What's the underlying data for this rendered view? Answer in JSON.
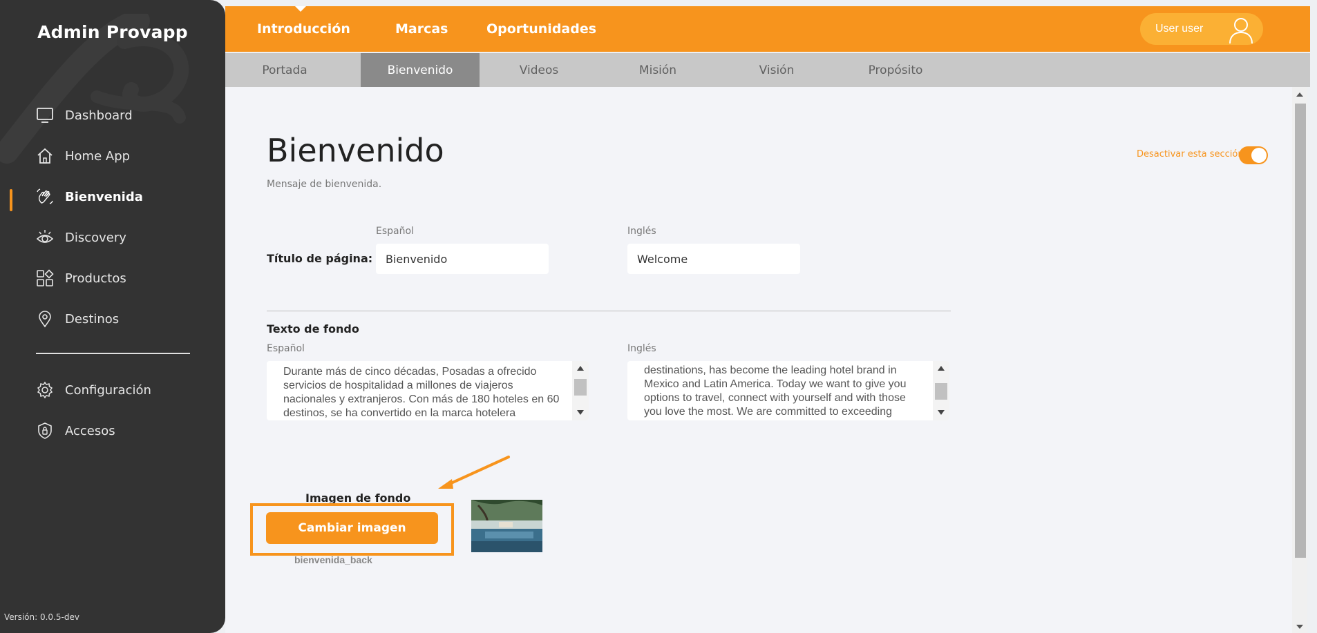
{
  "sidebar": {
    "brand": "Admin Provapp",
    "items": [
      {
        "label": "Dashboard",
        "icon": "monitor-icon"
      },
      {
        "label": "Home App",
        "icon": "home-icon"
      },
      {
        "label": "Bienvenida",
        "icon": "waving-hand-icon",
        "active": true
      },
      {
        "label": "Discovery",
        "icon": "eye-icon"
      },
      {
        "label": "Productos",
        "icon": "grid-shapes-icon"
      },
      {
        "label": "Destinos",
        "icon": "map-pin-icon"
      }
    ],
    "bottom_items": [
      {
        "label": "Configuración",
        "icon": "gear-icon"
      },
      {
        "label": "Accesos",
        "icon": "shield-lock-icon"
      }
    ],
    "version": "Versión: 0.0.5-dev"
  },
  "topbar": {
    "tabs": [
      "Introducción",
      "Marcas",
      "Oportunidades"
    ],
    "active_tab": "Introducción",
    "user_label": "User user"
  },
  "subtabs": {
    "items": [
      "Portada",
      "Bienvenido",
      "Videos",
      "Misión",
      "Visión",
      "Propósito"
    ],
    "active": "Bienvenido"
  },
  "page": {
    "title": "Bienvenido",
    "subtitle": "Mensaje de bienvenida.",
    "toggle_label": "Desactivar esta sección",
    "toggle_on": true
  },
  "form": {
    "lang_es": "Español",
    "lang_en": "Inglés",
    "title_label": "Título de página:",
    "title_es": "Bienvenido",
    "title_en": "Welcome",
    "background_text_label": "Texto de fondo",
    "background_text_es": "Durante más de cinco décadas, Posadas a ofrecido servicios de hospitalidad a millones de viajeros nacionales y extranjeros. Con más de 180 hoteles en 60 destinos, se ha convertido en la marca hotelera",
    "background_text_en": "destinations, has become the leading hotel brand in Mexico and Latin America. Today we want to give you options to travel, connect with yourself and with those you love the most. We are committed to exceeding",
    "image_label": "Imagen de fondo",
    "change_image_button": "Cambiar imagen",
    "image_file_name": "bienvenida_back"
  },
  "colors": {
    "accent": "#f7941d",
    "sidebar_bg": "#333333",
    "subbar_bg": "#c8c8c8",
    "subtab_active_bg": "#8a8a8a"
  }
}
